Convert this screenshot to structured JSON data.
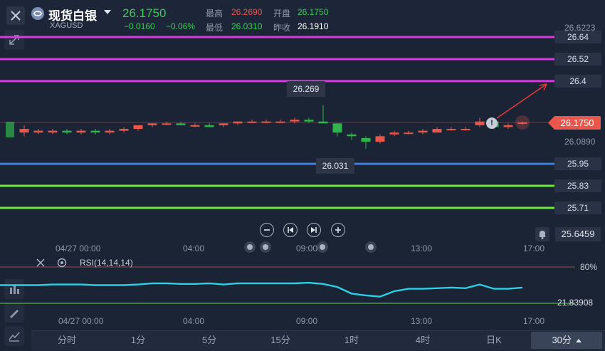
{
  "header": {
    "close_icon": "close-icon",
    "product_name": "现货白银",
    "symbol": "XAGUSD",
    "price": "26.1750",
    "change": "−0.0160",
    "change_pct": "−0.06%",
    "high_label": "最高",
    "high_value": "26.2690",
    "open_label": "开盘",
    "open_value": "26.1750",
    "low_label": "最低",
    "low_value": "26.0310",
    "prev_close_label": "昨收",
    "prev_close_value": "26.1910"
  },
  "colors": {
    "up": "#e8564c",
    "down": "#2fb34a",
    "magenta": "#d63be0",
    "blue": "#3f7fe8",
    "green_line": "#6bea3c",
    "rsi": "#2bd0e6",
    "background": "#1b2435"
  },
  "price_axis": {
    "top_value": "26.6223",
    "mid_value": "26.0890",
    "bottom_value": "25.6459",
    "current_price": "26.1750"
  },
  "lines": [
    {
      "label": "26.64",
      "value": 26.64,
      "color": "#d63be0"
    },
    {
      "label": "26.52",
      "value": 26.52,
      "color": "#d63be0"
    },
    {
      "label": "26.4",
      "value": 26.4,
      "color": "#d63be0"
    },
    {
      "label": "25.95",
      "value": 25.95,
      "color": "#3f7fe8"
    },
    {
      "label": "25.83",
      "value": 25.83,
      "color": "#6bea3c"
    },
    {
      "label": "25.71",
      "value": 25.71,
      "color": "#6bea3c"
    }
  ],
  "annotations": {
    "high_marker": "26.269",
    "low_marker": "26.031"
  },
  "time_axis": [
    "04/27 00:00",
    "04:00",
    "09:00",
    "13:00",
    "17:00"
  ],
  "indicator": {
    "name": "RSI(14,14,14)",
    "level_80": "80%",
    "value": "21.83908"
  },
  "timeframes": [
    "分时",
    "1分",
    "5分",
    "15分",
    "1时",
    "4时",
    "日K",
    "30分"
  ],
  "selected_timeframe": "30分",
  "chart_controls": [
    "zoom-out",
    "step-back",
    "step-forward",
    "zoom-in"
  ],
  "chart_data": {
    "type": "candlestick",
    "candles": [
      {
        "o": 26.12,
        "c": 26.14,
        "h": 26.16,
        "l": 26.1
      },
      {
        "o": 26.12,
        "c": 26.13,
        "h": 26.14,
        "l": 26.11
      },
      {
        "o": 26.12,
        "c": 26.13,
        "h": 26.14,
        "l": 26.11
      },
      {
        "o": 26.13,
        "c": 26.12,
        "h": 26.14,
        "l": 26.11
      },
      {
        "o": 26.12,
        "c": 26.13,
        "h": 26.14,
        "l": 26.11
      },
      {
        "o": 26.13,
        "c": 26.12,
        "h": 26.14,
        "l": 26.11
      },
      {
        "o": 26.12,
        "c": 26.13,
        "h": 26.14,
        "l": 26.11
      },
      {
        "o": 26.13,
        "c": 26.14,
        "h": 26.15,
        "l": 26.12
      },
      {
        "o": 26.14,
        "c": 26.16,
        "h": 26.16,
        "l": 26.13
      },
      {
        "o": 26.16,
        "c": 26.17,
        "h": 26.17,
        "l": 26.15
      },
      {
        "o": 26.17,
        "c": 26.17,
        "h": 26.18,
        "l": 26.16
      },
      {
        "o": 26.17,
        "c": 26.16,
        "h": 26.18,
        "l": 26.16
      },
      {
        "o": 26.16,
        "c": 26.16,
        "h": 26.17,
        "l": 26.15
      },
      {
        "o": 26.16,
        "c": 26.15,
        "h": 26.17,
        "l": 26.15
      },
      {
        "o": 26.16,
        "c": 26.17,
        "h": 26.17,
        "l": 26.15
      },
      {
        "o": 26.17,
        "c": 26.18,
        "h": 26.18,
        "l": 26.16
      },
      {
        "o": 26.18,
        "c": 26.18,
        "h": 26.19,
        "l": 26.17
      },
      {
        "o": 26.18,
        "c": 26.18,
        "h": 26.19,
        "l": 26.17
      },
      {
        "o": 26.18,
        "c": 26.18,
        "h": 26.19,
        "l": 26.17
      },
      {
        "o": 26.18,
        "c": 26.19,
        "h": 26.2,
        "l": 26.17
      },
      {
        "o": 26.19,
        "c": 26.18,
        "h": 26.2,
        "l": 26.17
      },
      {
        "o": 26.18,
        "c": 26.17,
        "h": 26.269,
        "l": 26.17
      },
      {
        "o": 26.17,
        "c": 26.12,
        "h": 26.17,
        "l": 26.1
      },
      {
        "o": 26.11,
        "c": 26.1,
        "h": 26.12,
        "l": 26.08
      },
      {
        "o": 26.09,
        "c": 26.07,
        "h": 26.1,
        "l": 26.031
      },
      {
        "o": 26.07,
        "c": 26.1,
        "h": 26.11,
        "l": 26.06
      },
      {
        "o": 26.11,
        "c": 26.12,
        "h": 26.13,
        "l": 26.1
      },
      {
        "o": 26.12,
        "c": 26.12,
        "h": 26.13,
        "l": 26.11
      },
      {
        "o": 26.12,
        "c": 26.13,
        "h": 26.14,
        "l": 26.11
      },
      {
        "o": 26.12,
        "c": 26.14,
        "h": 26.15,
        "l": 26.12
      },
      {
        "o": 26.14,
        "c": 26.14,
        "h": 26.15,
        "l": 26.13
      },
      {
        "o": 26.14,
        "c": 26.14,
        "h": 26.15,
        "l": 26.13
      },
      {
        "o": 26.16,
        "c": 26.18,
        "h": 26.2,
        "l": 26.15
      },
      {
        "o": 26.18,
        "c": 26.15,
        "h": 26.19,
        "l": 26.14
      },
      {
        "o": 26.15,
        "c": 26.16,
        "h": 26.17,
        "l": 26.14
      },
      {
        "o": 26.17,
        "c": 26.175,
        "h": 26.18,
        "l": 26.16
      }
    ],
    "rsi": [
      50,
      50,
      51,
      51,
      51,
      50,
      50,
      50,
      51,
      53,
      53,
      52,
      52,
      53,
      51,
      53,
      53,
      53,
      53,
      53,
      54,
      52,
      47,
      36,
      33,
      31,
      40,
      44,
      44,
      45,
      46,
      45,
      51,
      44,
      44,
      46
    ],
    "ylim": [
      25.6459,
      26.6223
    ]
  }
}
